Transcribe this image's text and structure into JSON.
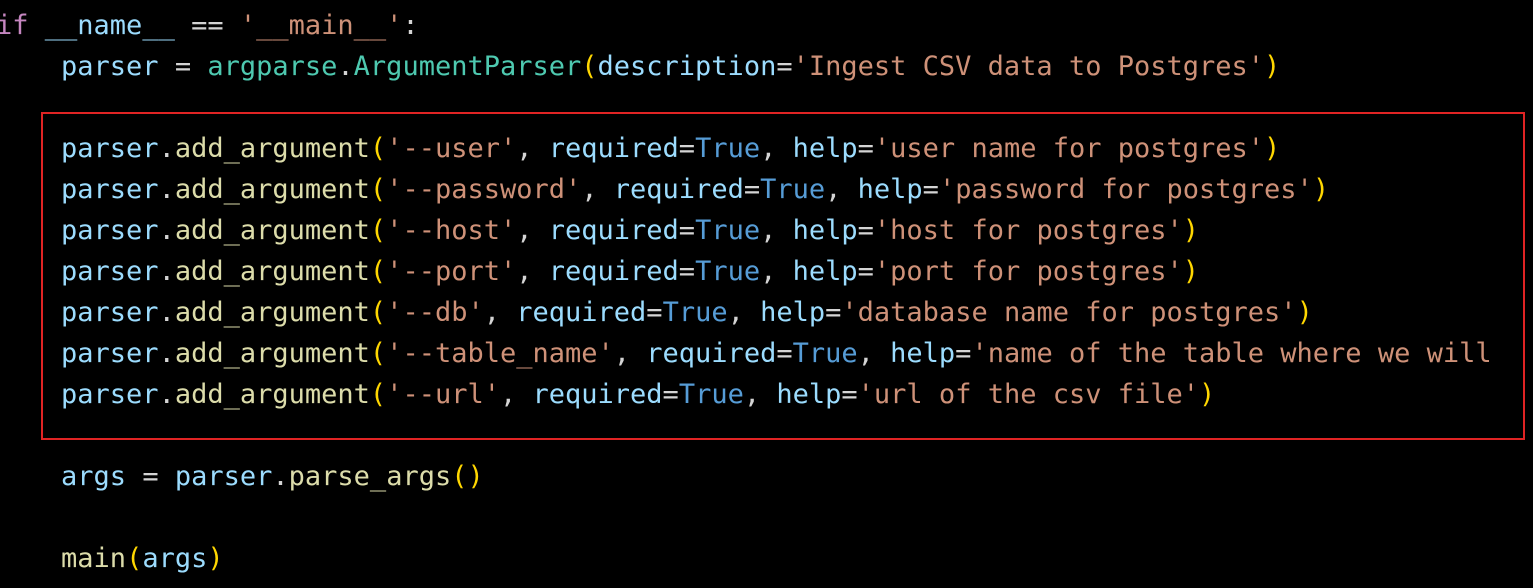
{
  "editor": {
    "highlight_color": "#e02424",
    "background": "#000000",
    "colors": {
      "keyword": "#c586c0",
      "variable": "#9cdcfe",
      "function": "#dcdcaa",
      "class": "#4ec9b0",
      "string": "#ce9178",
      "constant": "#569cd6",
      "bracket_level1": "#ffd700",
      "plain": "#d4d4d4"
    },
    "lines": [
      [
        {
          "t": "if",
          "c": "keyword"
        },
        {
          "t": " ",
          "c": "plain"
        },
        {
          "t": "__name__",
          "c": "variable"
        },
        {
          "t": " == ",
          "c": "plain"
        },
        {
          "t": "'__main__'",
          "c": "string"
        },
        {
          "t": ":",
          "c": "plain"
        }
      ],
      [
        {
          "t": "    ",
          "c": "plain"
        },
        {
          "t": "parser",
          "c": "variable"
        },
        {
          "t": " = ",
          "c": "plain"
        },
        {
          "t": "argparse",
          "c": "class"
        },
        {
          "t": ".",
          "c": "plain"
        },
        {
          "t": "ArgumentParser",
          "c": "class"
        },
        {
          "t": "(",
          "c": "bracket_level1"
        },
        {
          "t": "description",
          "c": "variable"
        },
        {
          "t": "=",
          "c": "plain"
        },
        {
          "t": "'Ingest CSV data to Postgres'",
          "c": "string"
        },
        {
          "t": ")",
          "c": "bracket_level1"
        }
      ],
      [],
      [
        {
          "t": "    ",
          "c": "plain"
        },
        {
          "t": "parser",
          "c": "variable"
        },
        {
          "t": ".",
          "c": "plain"
        },
        {
          "t": "add_argument",
          "c": "function"
        },
        {
          "t": "(",
          "c": "bracket_level1"
        },
        {
          "t": "'--user'",
          "c": "string"
        },
        {
          "t": ", ",
          "c": "plain"
        },
        {
          "t": "required",
          "c": "variable"
        },
        {
          "t": "=",
          "c": "plain"
        },
        {
          "t": "True",
          "c": "constant"
        },
        {
          "t": ", ",
          "c": "plain"
        },
        {
          "t": "help",
          "c": "variable"
        },
        {
          "t": "=",
          "c": "plain"
        },
        {
          "t": "'user name for postgres'",
          "c": "string"
        },
        {
          "t": ")",
          "c": "bracket_level1"
        }
      ],
      [
        {
          "t": "    ",
          "c": "plain"
        },
        {
          "t": "parser",
          "c": "variable"
        },
        {
          "t": ".",
          "c": "plain"
        },
        {
          "t": "add_argument",
          "c": "function"
        },
        {
          "t": "(",
          "c": "bracket_level1"
        },
        {
          "t": "'--password'",
          "c": "string"
        },
        {
          "t": ", ",
          "c": "plain"
        },
        {
          "t": "required",
          "c": "variable"
        },
        {
          "t": "=",
          "c": "plain"
        },
        {
          "t": "True",
          "c": "constant"
        },
        {
          "t": ", ",
          "c": "plain"
        },
        {
          "t": "help",
          "c": "variable"
        },
        {
          "t": "=",
          "c": "plain"
        },
        {
          "t": "'password for postgres'",
          "c": "string"
        },
        {
          "t": ")",
          "c": "bracket_level1"
        }
      ],
      [
        {
          "t": "    ",
          "c": "plain"
        },
        {
          "t": "parser",
          "c": "variable"
        },
        {
          "t": ".",
          "c": "plain"
        },
        {
          "t": "add_argument",
          "c": "function"
        },
        {
          "t": "(",
          "c": "bracket_level1"
        },
        {
          "t": "'--host'",
          "c": "string"
        },
        {
          "t": ", ",
          "c": "plain"
        },
        {
          "t": "required",
          "c": "variable"
        },
        {
          "t": "=",
          "c": "plain"
        },
        {
          "t": "True",
          "c": "constant"
        },
        {
          "t": ", ",
          "c": "plain"
        },
        {
          "t": "help",
          "c": "variable"
        },
        {
          "t": "=",
          "c": "plain"
        },
        {
          "t": "'host for postgres'",
          "c": "string"
        },
        {
          "t": ")",
          "c": "bracket_level1"
        }
      ],
      [
        {
          "t": "    ",
          "c": "plain"
        },
        {
          "t": "parser",
          "c": "variable"
        },
        {
          "t": ".",
          "c": "plain"
        },
        {
          "t": "add_argument",
          "c": "function"
        },
        {
          "t": "(",
          "c": "bracket_level1"
        },
        {
          "t": "'--port'",
          "c": "string"
        },
        {
          "t": ", ",
          "c": "plain"
        },
        {
          "t": "required",
          "c": "variable"
        },
        {
          "t": "=",
          "c": "plain"
        },
        {
          "t": "True",
          "c": "constant"
        },
        {
          "t": ", ",
          "c": "plain"
        },
        {
          "t": "help",
          "c": "variable"
        },
        {
          "t": "=",
          "c": "plain"
        },
        {
          "t": "'port for postgres'",
          "c": "string"
        },
        {
          "t": ")",
          "c": "bracket_level1"
        }
      ],
      [
        {
          "t": "    ",
          "c": "plain"
        },
        {
          "t": "parser",
          "c": "variable"
        },
        {
          "t": ".",
          "c": "plain"
        },
        {
          "t": "add_argument",
          "c": "function"
        },
        {
          "t": "(",
          "c": "bracket_level1"
        },
        {
          "t": "'--db'",
          "c": "string"
        },
        {
          "t": ", ",
          "c": "plain"
        },
        {
          "t": "required",
          "c": "variable"
        },
        {
          "t": "=",
          "c": "plain"
        },
        {
          "t": "True",
          "c": "constant"
        },
        {
          "t": ", ",
          "c": "plain"
        },
        {
          "t": "help",
          "c": "variable"
        },
        {
          "t": "=",
          "c": "plain"
        },
        {
          "t": "'database name for postgres'",
          "c": "string"
        },
        {
          "t": ")",
          "c": "bracket_level1"
        }
      ],
      [
        {
          "t": "    ",
          "c": "plain"
        },
        {
          "t": "parser",
          "c": "variable"
        },
        {
          "t": ".",
          "c": "plain"
        },
        {
          "t": "add_argument",
          "c": "function"
        },
        {
          "t": "(",
          "c": "bracket_level1"
        },
        {
          "t": "'--table_name'",
          "c": "string"
        },
        {
          "t": ", ",
          "c": "plain"
        },
        {
          "t": "required",
          "c": "variable"
        },
        {
          "t": "=",
          "c": "plain"
        },
        {
          "t": "True",
          "c": "constant"
        },
        {
          "t": ", ",
          "c": "plain"
        },
        {
          "t": "help",
          "c": "variable"
        },
        {
          "t": "=",
          "c": "plain"
        },
        {
          "t": "'name of the table where we will",
          "c": "string"
        }
      ],
      [
        {
          "t": "    ",
          "c": "plain"
        },
        {
          "t": "parser",
          "c": "variable"
        },
        {
          "t": ".",
          "c": "plain"
        },
        {
          "t": "add_argument",
          "c": "function"
        },
        {
          "t": "(",
          "c": "bracket_level1"
        },
        {
          "t": "'--url'",
          "c": "string"
        },
        {
          "t": ", ",
          "c": "plain"
        },
        {
          "t": "required",
          "c": "variable"
        },
        {
          "t": "=",
          "c": "plain"
        },
        {
          "t": "True",
          "c": "constant"
        },
        {
          "t": ", ",
          "c": "plain"
        },
        {
          "t": "help",
          "c": "variable"
        },
        {
          "t": "=",
          "c": "plain"
        },
        {
          "t": "'url of the csv file'",
          "c": "string"
        },
        {
          "t": ")",
          "c": "bracket_level1"
        }
      ],
      [],
      [
        {
          "t": "    ",
          "c": "plain"
        },
        {
          "t": "args",
          "c": "variable"
        },
        {
          "t": " = ",
          "c": "plain"
        },
        {
          "t": "parser",
          "c": "variable"
        },
        {
          "t": ".",
          "c": "plain"
        },
        {
          "t": "parse_args",
          "c": "function"
        },
        {
          "t": "()",
          "c": "bracket_level1"
        }
      ],
      [],
      [
        {
          "t": "    ",
          "c": "plain"
        },
        {
          "t": "main",
          "c": "function"
        },
        {
          "t": "(",
          "c": "bracket_level1"
        },
        {
          "t": "args",
          "c": "variable"
        },
        {
          "t": ")",
          "c": "bracket_level1"
        }
      ]
    ]
  }
}
